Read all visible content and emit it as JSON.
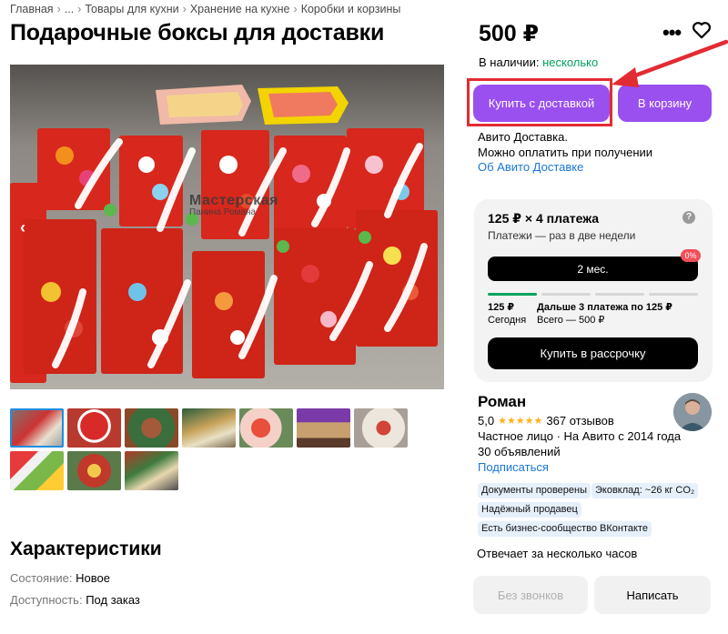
{
  "breadcrumb": [
    "Главная",
    "...",
    "Товары для кухни",
    "Хранение на кухне",
    "Коробки и корзины"
  ],
  "title": "Подарочные боксы для доставки",
  "gallery": {
    "nav_prev": "‹",
    "watermark_line1": "Мастерская",
    "watermark_line2": "Панина Романа",
    "brand": "Avito",
    "thumbnail_count": 10,
    "active_thumbnail": 1
  },
  "characteristics": {
    "title": "Характеристики",
    "rows": [
      {
        "key": "Состояние:",
        "value": "Новое"
      },
      {
        "key": "Доступность:",
        "value": "Под заказ"
      }
    ]
  },
  "price": "500 ₽",
  "more_icon": "•••",
  "stock": {
    "label": "В наличии:",
    "value": "несколько"
  },
  "buttons": {
    "buy_delivery": "Купить с доставкой",
    "cart": "В корзину",
    "installment": "Купить в рассрочку",
    "no_calls": "Без звонков",
    "write": "Написать"
  },
  "delivery": {
    "line1": "Авито Доставка.",
    "line2": "Можно оплатить при получении",
    "link": "Об Авито Доставке"
  },
  "installment": {
    "title": "125 ₽ × 4 платежа",
    "subtitle": "Платежи — раз в две недели",
    "period": "2 мес.",
    "badge": "0%",
    "first_amount": "125 ₽",
    "first_label": "Сегодня",
    "rest_amount": "Дальше 3 платежа по 125 ₽",
    "total": "Всего — 500 ₽",
    "paid_segments": 1,
    "total_segments": 4
  },
  "seller": {
    "name": "Роман",
    "rating": "5,0",
    "stars": "★★★★★",
    "reviews": "367 отзывов",
    "type": "Частное лицо · На Авито с 2014 года",
    "ads": "30 объявлений",
    "subscribe": "Подписаться",
    "tags": [
      "Документы проверены",
      "Эковклад: ~26 кг CO₂",
      "Надёжный продавец",
      "Есть бизнес-сообщество ВКонтакте"
    ],
    "reply_time": "Отвечает за несколько часов"
  },
  "colors": {
    "accent": "#9a4fef",
    "link": "#1a77d5",
    "in_stock": "#02a35c",
    "annotation": "#e32b33",
    "star": "#ffb021"
  }
}
